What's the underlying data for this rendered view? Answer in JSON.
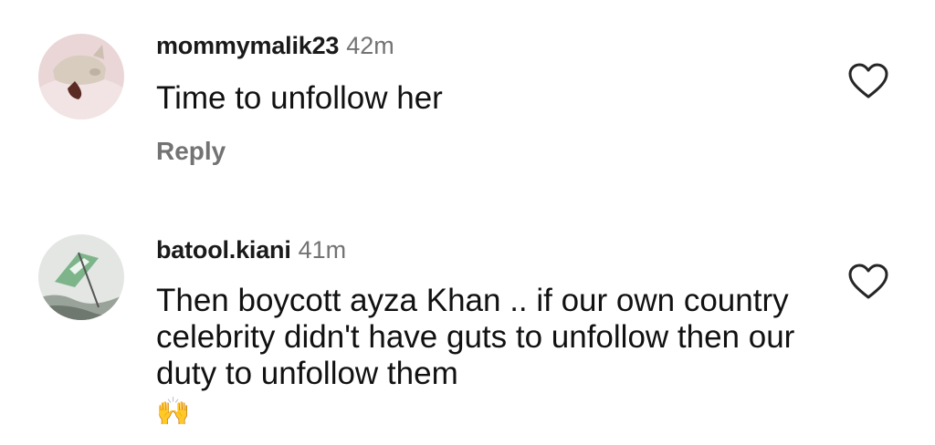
{
  "comments": [
    {
      "username": "mommymalik23",
      "time": "42m",
      "text": "Time to unfollow her",
      "reply_label": "Reply",
      "like_icon": "heart-outline-icon"
    },
    {
      "username": "batool.kiani",
      "time": "41m",
      "text": "Then boycott ayza Khan .. if our own country celebrity didn't have guts to unfollow then our duty to unfollow them",
      "emoji": "🙌",
      "like_icon": "heart-outline-icon"
    }
  ],
  "colors": {
    "text_primary": "#111111",
    "text_secondary": "#737373"
  }
}
